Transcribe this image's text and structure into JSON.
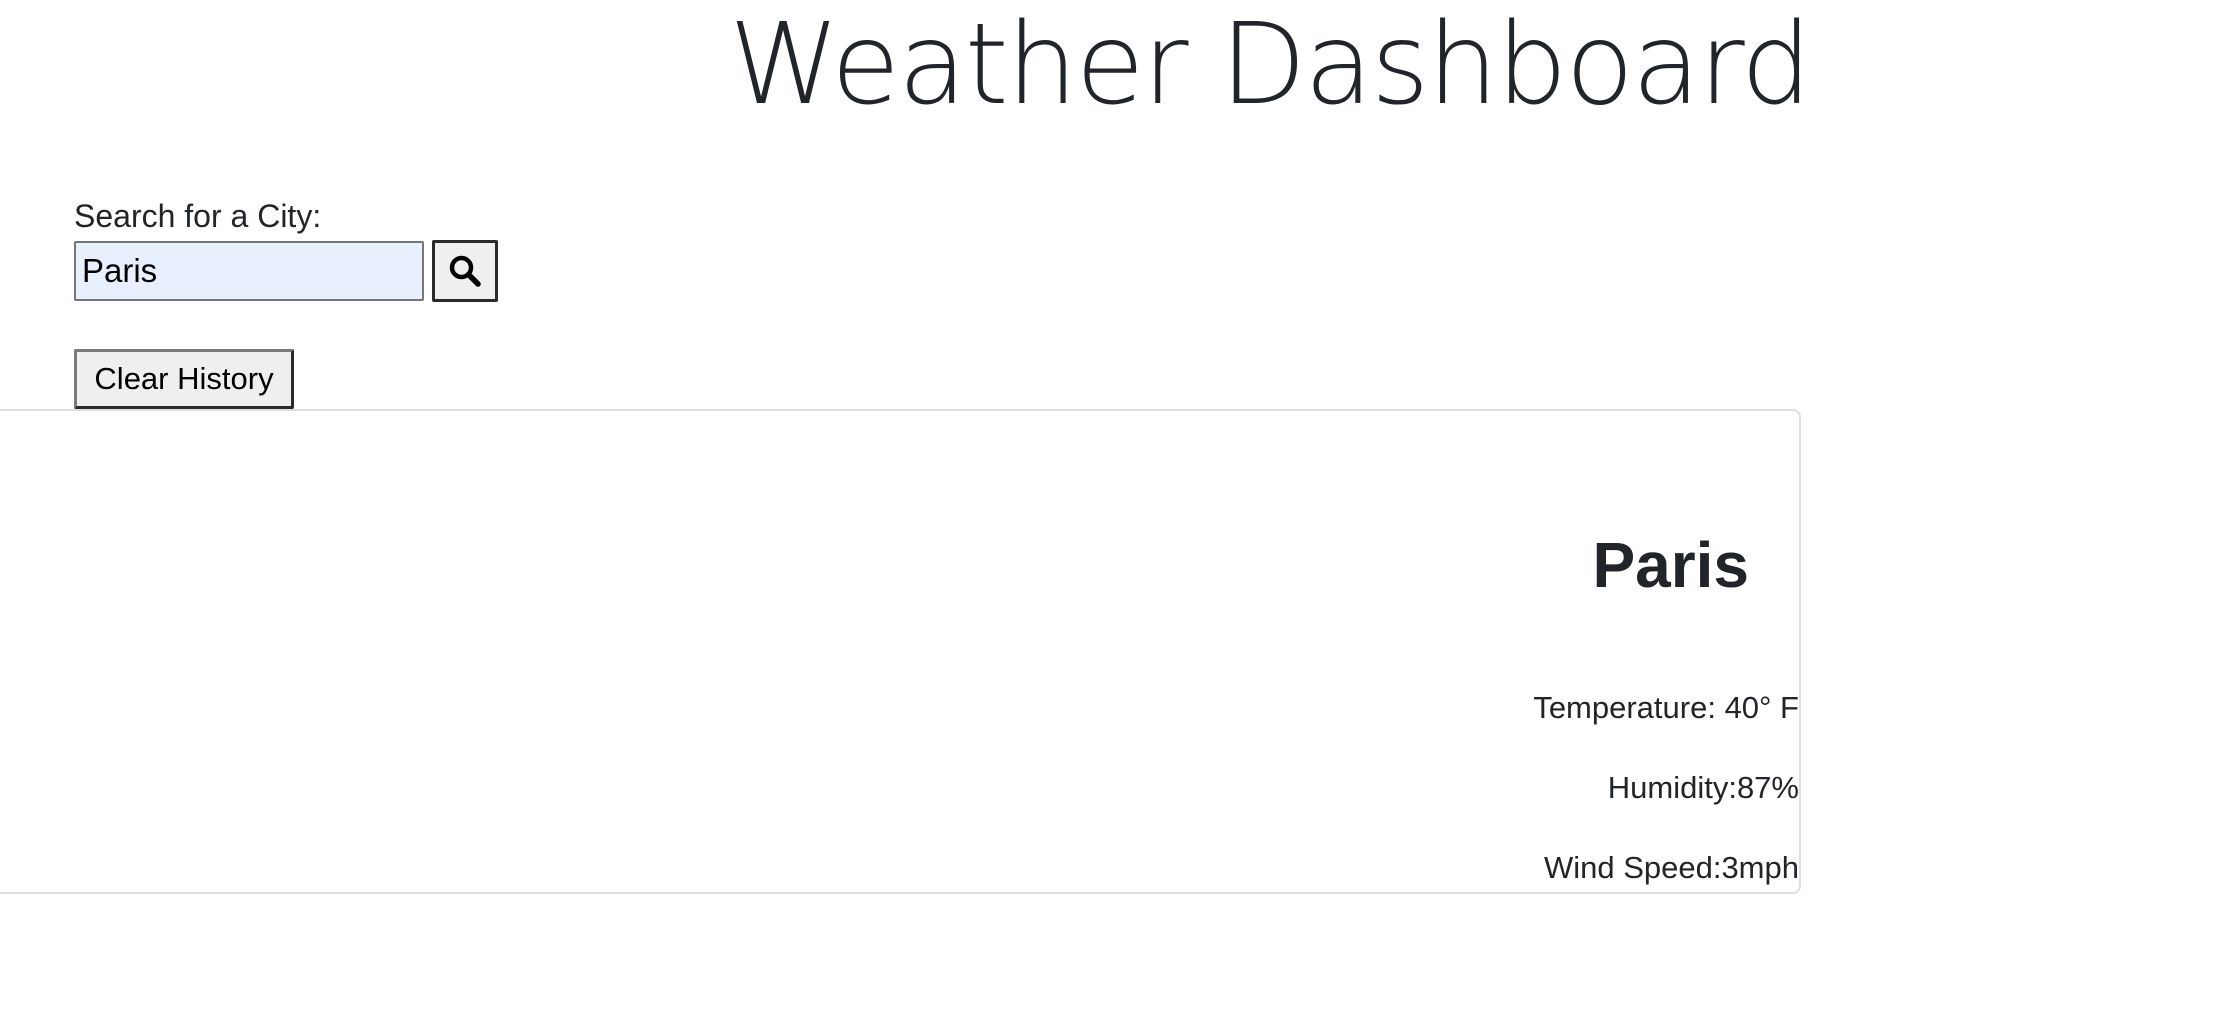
{
  "header": {
    "title": "Weather Dashboard"
  },
  "search": {
    "label": "Search for a City:",
    "value": "Paris",
    "placeholder": "",
    "button_icon": "search-icon"
  },
  "history": {
    "clear_label": "Clear History"
  },
  "weather": {
    "city": "Paris",
    "temperature": "Temperature: 40° F",
    "humidity": "Humidity:87%",
    "wind_speed": "Wind Speed:3mph"
  },
  "colors": {
    "text": "#212529",
    "input_background": "#e8f0fe",
    "button_background": "#efefef",
    "card_border": "#dfdfdf"
  }
}
